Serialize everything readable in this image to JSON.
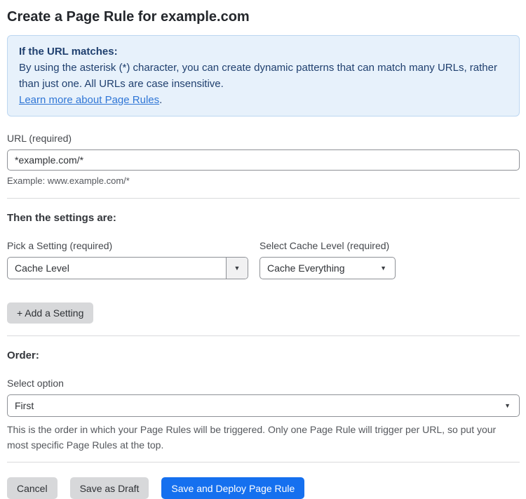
{
  "page": {
    "title": "Create a Page Rule for example.com"
  },
  "info_box": {
    "heading": "If the URL matches:",
    "body": "By using the asterisk (*) character, you can create dynamic patterns that can match many URLs, rather than just one. All URLs are case insensitive.",
    "link_label": "Learn more about Page Rules",
    "link_suffix": "."
  },
  "url_field": {
    "label": "URL (required)",
    "value": "*example.com/*",
    "hint": "Example: www.example.com/*"
  },
  "settings_section": {
    "heading": "Then the settings are:",
    "setting_picker": {
      "label": "Pick a Setting (required)",
      "value": "Cache Level"
    },
    "cache_level_picker": {
      "label": "Select Cache Level (required)",
      "value": "Cache Everything"
    },
    "add_setting_label": "+ Add a Setting"
  },
  "order_section": {
    "heading": "Order:",
    "label": "Select option",
    "value": "First",
    "description": "This is the order in which your Page Rules will be triggered. Only one Page Rule will trigger per URL, so put your most specific Page Rules at the top."
  },
  "footer": {
    "cancel_label": "Cancel",
    "save_draft_label": "Save as Draft",
    "save_deploy_label": "Save and Deploy Page Rule"
  },
  "icons": {
    "dropdown_arrow": "▼"
  },
  "colors": {
    "accent_blue": "#1570ef",
    "info_box_bg": "#e7f1fb",
    "info_box_border": "#bdd7f1",
    "info_text": "#20406f",
    "link_blue": "#2f76d6",
    "button_gray": "#d7d8da",
    "input_border": "#8e9196",
    "divider": "#d9dadc"
  }
}
